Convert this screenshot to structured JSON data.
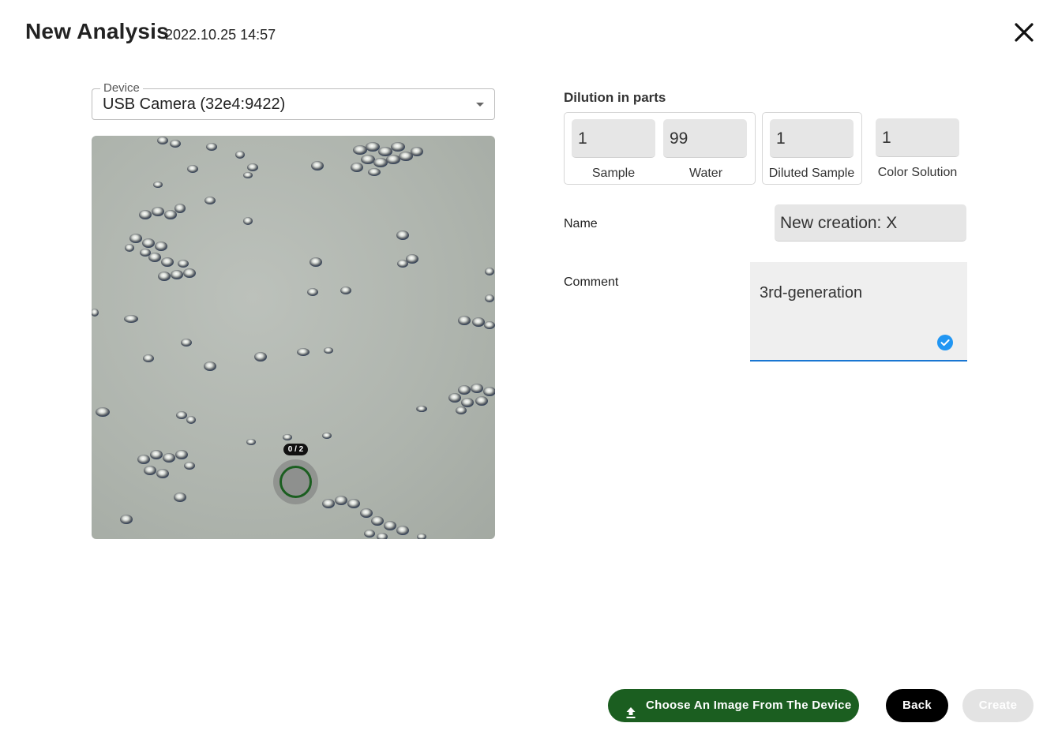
{
  "header": {
    "title": "New Analysis",
    "datetime": "2022.10.25 14:57"
  },
  "device": {
    "label": "Device",
    "value": "USB Camera (32e4:9422)"
  },
  "preview": {
    "counter": "0 / 2"
  },
  "dilution": {
    "title": "Dilution in parts",
    "sample": {
      "value": "1",
      "label": "Sample"
    },
    "water": {
      "value": "99",
      "label": "Water"
    },
    "diluted_sample": {
      "value": "1",
      "label": "Diluted Sample"
    },
    "color_solution": {
      "value": "1",
      "label": "Color Solution"
    }
  },
  "form": {
    "name_label": "Name",
    "name_value": "New creation: X",
    "comment_label": "Comment",
    "comment_value": "3rd-generation"
  },
  "buttons": {
    "upload": "Choose An Image From The Device",
    "back": "Back",
    "create": "Create"
  },
  "colors": {
    "primary_green": "#1b5e20",
    "focus_blue": "#1976d2",
    "disabled": "#e3e3e3"
  }
}
